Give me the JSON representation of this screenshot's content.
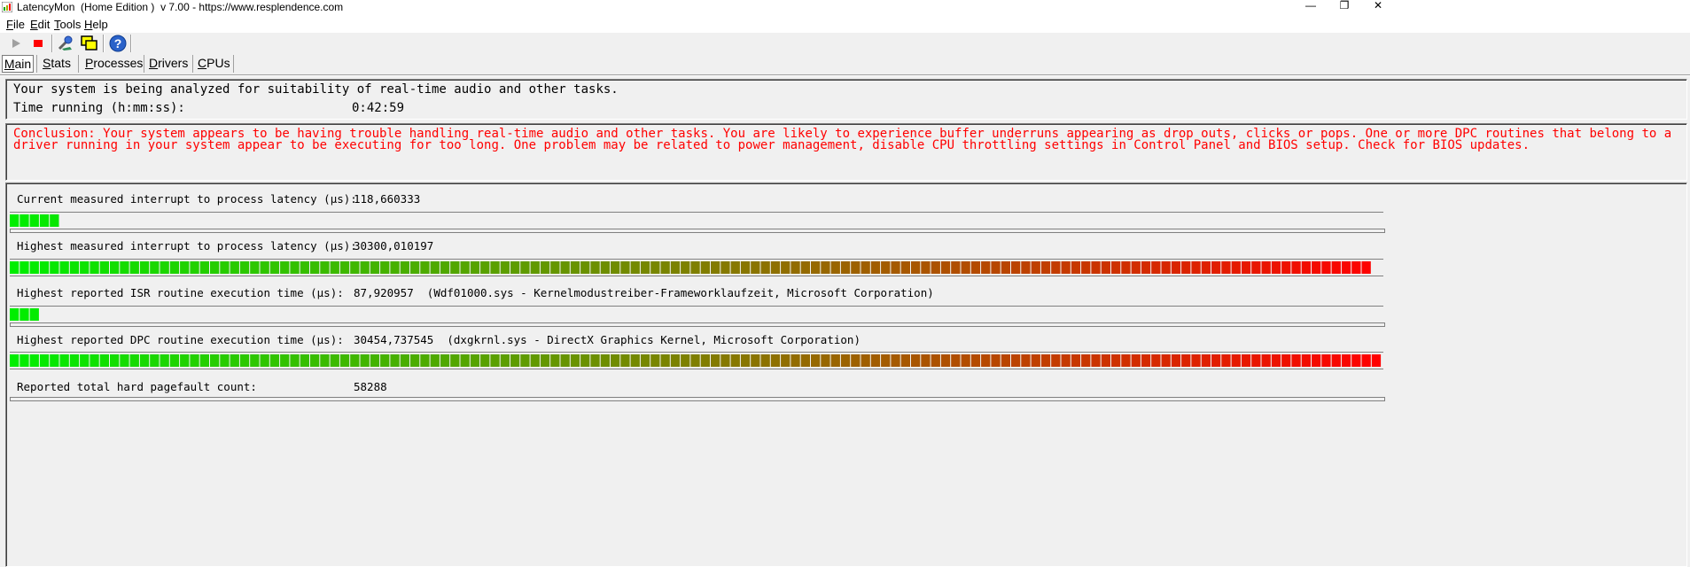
{
  "window": {
    "title": "LatencyMon  (Home Edition )  v 7.00 - https://www.resplendence.com",
    "minimize_glyph": "—",
    "maximize_glyph": "❐",
    "close_glyph": "✕"
  },
  "menu": [
    {
      "label": "File",
      "ul": "F",
      "rest": "ile"
    },
    {
      "label": "Edit",
      "ul": "E",
      "rest": "dit"
    },
    {
      "label": "Tools",
      "ul": "T",
      "rest": "ools"
    },
    {
      "label": "Help",
      "ul": "H",
      "rest": "elp"
    }
  ],
  "toolbar": {
    "icons": [
      "play-icon",
      "stop-icon",
      "tools-icon",
      "windows-icon",
      "help-icon"
    ]
  },
  "tabs": [
    {
      "ul": "M",
      "rest": "ain",
      "active": true
    },
    {
      "ul": "S",
      "rest": "tats",
      "active": false
    },
    {
      "ul": "P",
      "rest": "rocesses",
      "active": false
    },
    {
      "ul": "D",
      "rest": "rivers",
      "active": false
    },
    {
      "ul": "C",
      "rest": "PUs",
      "active": false
    }
  ],
  "summary": {
    "headline": "Your system is being analyzed for suitability of real-time audio and other tasks.",
    "time_label": "Time running (h:mm:ss):",
    "time_value": "0:42:59"
  },
  "conclusion": "Conclusion: Your system appears to be having trouble handling real-time audio and other tasks. You are likely to experience buffer underruns appearing as drop outs, clicks or pops. One or more DPC routines that belong to a driver running in your system appear to be executing for too long. One problem may be related to power management, disable CPU throttling settings in Control Panel and BIOS setup. Check for BIOS updates.",
  "metrics": [
    {
      "label": "Current measured interrupt to process latency (µs):",
      "value": "118,660333",
      "detail": "",
      "bar_level": 0.033
    },
    {
      "label": "Highest measured interrupt to process latency (µs):",
      "value": "30300,010197",
      "detail": "",
      "bar_level": 0.993
    },
    {
      "label": "Highest reported ISR routine execution time (µs):",
      "value": "87,920957",
      "detail": "(Wdf01000.sys - Kernelmodustreiber-Frameworklaufzeit, Microsoft Corporation)",
      "bar_level": 0.025
    },
    {
      "label": "Highest reported DPC routine execution time (µs):",
      "value": "30454,737545",
      "detail": "(dxgkrnl.sys - DirectX Graphics Kernel, Microsoft Corporation)",
      "bar_level": 1.0
    },
    {
      "label": "Reported total hard pagefault count:",
      "value": "58288",
      "detail": "",
      "bar_level": null
    }
  ],
  "colors": {
    "bar_start": "#00ee00",
    "bar_mid": "#7f7f00",
    "bar_end": "#ff0000",
    "conclusion_text": "#ff0000"
  }
}
